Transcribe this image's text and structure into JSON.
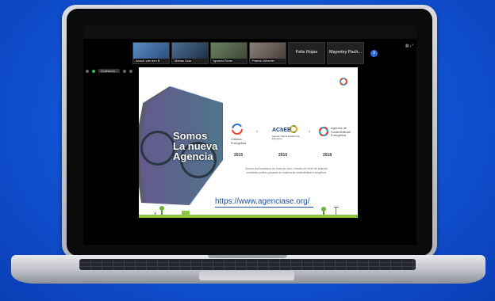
{
  "participants": [
    {
      "name": "Anouk van den B",
      "kind": "video",
      "tone": "#5a8fc7"
    },
    {
      "name": "Matías Díaz",
      "kind": "video",
      "tone": "#4c6f96"
    },
    {
      "name": "Ignacio Rivas",
      "kind": "video",
      "tone": "#6b7f5e"
    },
    {
      "name": "Patrick Wheeler",
      "kind": "video",
      "tone": "#7a6e6a"
    },
    {
      "name": "Felix Rojas",
      "kind": "text"
    },
    {
      "name": "Mayerley Pach...",
      "kind": "text"
    }
  ],
  "more_count": "3",
  "share_label": "Grabando...",
  "slide": {
    "headline": [
      "Somos",
      "La nueva",
      "Agencia"
    ],
    "timeline": [
      {
        "year": "2015",
        "logo": "Chilena Energética"
      },
      {
        "year": "2010",
        "logo": "AChEE",
        "sub": "Agencia Chilena de Eficiencia Energética"
      },
      {
        "year": "2018",
        "logo": "Agencia de Sostenibilidad Energética"
      }
    ],
    "paragraph": "Somos una fundación sin fines de lucro, creada con el fin de articular iniciativas público-privadas en materia de sostenibilidad energética.",
    "url": "https://www.agenciase.org/"
  },
  "colors": {
    "accent": "#2d6cdf",
    "rec": "#2ec24c"
  }
}
